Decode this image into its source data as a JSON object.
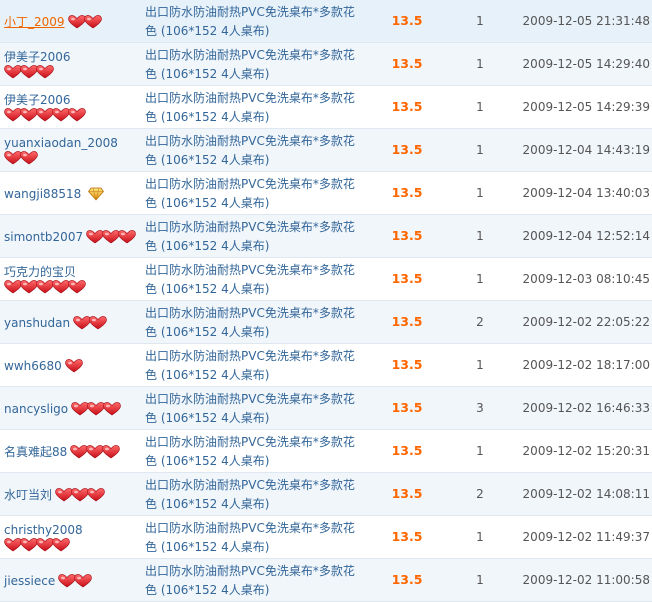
{
  "colors": {
    "buyer_link": "#336699",
    "selected_buyer": "#ee6600",
    "product_link": "#336699",
    "price": "#ff6600",
    "row_alt_bg": "#f1f6fb",
    "heart": "#e8202a",
    "diamond": "#f0b020"
  },
  "rating_icons": {
    "heart": "heart-rating-icon",
    "diamond": "diamond-rating-icon"
  },
  "records": [
    {
      "buyer": "小丁_2009",
      "selected": true,
      "level": "heart",
      "line1_icons": 2,
      "line2_icons": 0,
      "product": "出口防水防油耐热PVC免洗桌布*多款花色 (106*152 4人桌布)",
      "price": "13.5",
      "qty": "1",
      "time": "2009-12-05 21:31:48"
    },
    {
      "buyer": "伊美子2006",
      "selected": false,
      "level": "heart",
      "line1_icons": 0,
      "line2_icons": 3,
      "product": "出口防水防油耐热PVC免洗桌布*多款花色 (106*152 4人桌布)",
      "price": "13.5",
      "qty": "1",
      "time": "2009-12-05 14:29:40"
    },
    {
      "buyer": "伊美子2006",
      "selected": false,
      "level": "heart",
      "line1_icons": 0,
      "line2_icons": 5,
      "product": "出口防水防油耐热PVC免洗桌布*多款花色 (106*152 4人桌布)",
      "price": "13.5",
      "qty": "1",
      "time": "2009-12-05 14:29:39"
    },
    {
      "buyer": "yuanxiaodan_2008",
      "selected": false,
      "level": "heart",
      "line1_icons": 0,
      "line2_icons": 2,
      "product": "出口防水防油耐热PVC免洗桌布*多款花色 (106*152 4人桌布)",
      "price": "13.5",
      "qty": "1",
      "time": "2009-12-04 14:43:19"
    },
    {
      "buyer": "wangji88518",
      "selected": false,
      "level": "diamond",
      "line1_icons": 1,
      "line2_icons": 0,
      "product": "出口防水防油耐热PVC免洗桌布*多款花色 (106*152 4人桌布)",
      "price": "13.5",
      "qty": "1",
      "time": "2009-12-04 13:40:03"
    },
    {
      "buyer": "simontb2007",
      "selected": false,
      "level": "heart",
      "line1_icons": 3,
      "line2_icons": 0,
      "product": "出口防水防油耐热PVC免洗桌布*多款花色 (106*152 4人桌布)",
      "price": "13.5",
      "qty": "1",
      "time": "2009-12-04 12:52:14"
    },
    {
      "buyer": "巧克力的宝贝",
      "selected": false,
      "level": "heart",
      "line1_icons": 0,
      "line2_icons": 5,
      "product": "出口防水防油耐热PVC免洗桌布*多款花色 (106*152 4人桌布)",
      "price": "13.5",
      "qty": "1",
      "time": "2009-12-03 08:10:45"
    },
    {
      "buyer": "yanshudan",
      "selected": false,
      "level": "heart",
      "line1_icons": 2,
      "line2_icons": 0,
      "product": "出口防水防油耐热PVC免洗桌布*多款花色 (106*152 4人桌布)",
      "price": "13.5",
      "qty": "2",
      "time": "2009-12-02 22:05:22"
    },
    {
      "buyer": "wwh6680",
      "selected": false,
      "level": "heart",
      "line1_icons": 1,
      "line2_icons": 0,
      "product": "出口防水防油耐热PVC免洗桌布*多款花色 (106*152 4人桌布)",
      "price": "13.5",
      "qty": "1",
      "time": "2009-12-02 18:17:00"
    },
    {
      "buyer": "nancysligo",
      "selected": false,
      "level": "heart",
      "line1_icons": 3,
      "line2_icons": 0,
      "product": "出口防水防油耐热PVC免洗桌布*多款花色 (106*152 4人桌布)",
      "price": "13.5",
      "qty": "3",
      "time": "2009-12-02 16:46:33"
    },
    {
      "buyer": "名真难起88",
      "selected": false,
      "level": "heart",
      "line1_icons": 3,
      "line2_icons": 0,
      "product": "出口防水防油耐热PVC免洗桌布*多款花色 (106*152 4人桌布)",
      "price": "13.5",
      "qty": "1",
      "time": "2009-12-02 15:20:31"
    },
    {
      "buyer": "水叮当刘",
      "selected": false,
      "level": "heart",
      "line1_icons": 3,
      "line2_icons": 0,
      "product": "出口防水防油耐热PVC免洗桌布*多款花色 (106*152 4人桌布)",
      "price": "13.5",
      "qty": "2",
      "time": "2009-12-02 14:08:11"
    },
    {
      "buyer": "christhy2008",
      "selected": false,
      "level": "heart",
      "line1_icons": 0,
      "line2_icons": 4,
      "product": "出口防水防油耐热PVC免洗桌布*多款花色 (106*152 4人桌布)",
      "price": "13.5",
      "qty": "1",
      "time": "2009-12-02 11:49:37"
    },
    {
      "buyer": "jiessiece",
      "selected": false,
      "level": "heart",
      "line1_icons": 2,
      "line2_icons": 0,
      "product": "出口防水防油耐热PVC免洗桌布*多款花色 (106*152 4人桌布)",
      "price": "13.5",
      "qty": "1",
      "time": "2009-12-02 11:00:58"
    }
  ]
}
